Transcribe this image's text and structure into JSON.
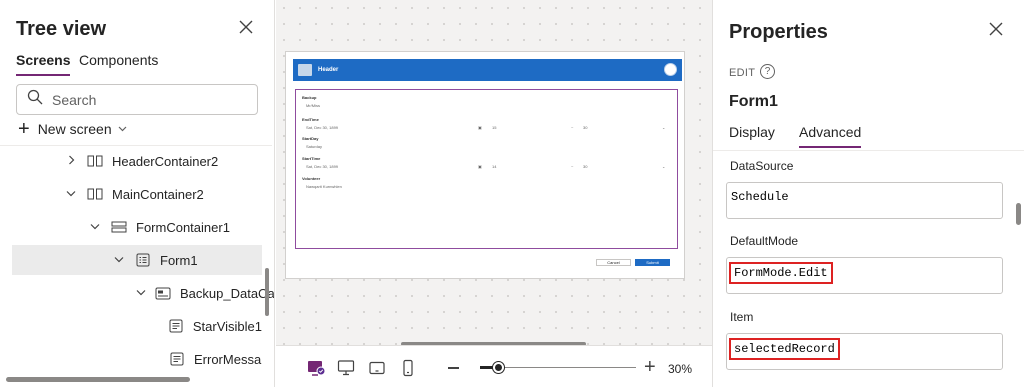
{
  "tree": {
    "title": "Tree view",
    "tabs": [
      {
        "label": "Screens",
        "active": true
      },
      {
        "label": "Components",
        "active": false
      }
    ],
    "search_placeholder": "Search",
    "new_screen_label": "New screen",
    "items": [
      {
        "label": "HeaderContainer2",
        "expand": "collapsed",
        "icon": "container-icon"
      },
      {
        "label": "MainContainer2",
        "expand": "expanded",
        "icon": "container-icon"
      },
      {
        "label": "FormContainer1",
        "expand": "expanded",
        "icon": "vertical-container-icon"
      },
      {
        "label": "Form1",
        "expand": "expanded",
        "icon": "form-icon",
        "selected": true
      },
      {
        "label": "Backup_DataCar",
        "expand": "expanded",
        "icon": "datacard-icon"
      },
      {
        "label": "StarVisible1",
        "icon": "label-icon"
      },
      {
        "label": "ErrorMessa",
        "icon": "label-icon"
      }
    ]
  },
  "canvas": {
    "header_title": "Header",
    "fields": [
      {
        "label": "Backup",
        "value": "Mr/Miss"
      },
      {
        "label": "EndTime",
        "value": "Sat, Dec 30, 1899",
        "hour": "15",
        "minute": "30"
      },
      {
        "label": "StartDay",
        "value": "Saturday"
      },
      {
        "label": "StartTime",
        "value": "Sat, Dec 30, 1899",
        "hour": "14",
        "minute": "30"
      },
      {
        "label": "Volunteer",
        "value": "Nawqarit Kurnwhlen"
      }
    ],
    "cancel_label": "Cancel",
    "submit_label": "Submit"
  },
  "bottombar": {
    "zoom_percent": 30,
    "zoom_label": "30%"
  },
  "props": {
    "title": "Properties",
    "mode_label": "EDIT",
    "control_name": "Form1",
    "tabs": [
      {
        "label": "Display",
        "active": false
      },
      {
        "label": "Advanced",
        "active": true
      }
    ],
    "fields": [
      {
        "label": "DataSource",
        "value": "Schedule",
        "highlight": false
      },
      {
        "label": "DefaultMode",
        "value": "FormMode.Edit",
        "highlight": true
      },
      {
        "label": "Item",
        "value": "selectedRecord",
        "highlight": true
      }
    ]
  },
  "colors": {
    "accent": "#742774",
    "app_header": "#1e6bc4",
    "highlight_box": "#dd2222"
  }
}
